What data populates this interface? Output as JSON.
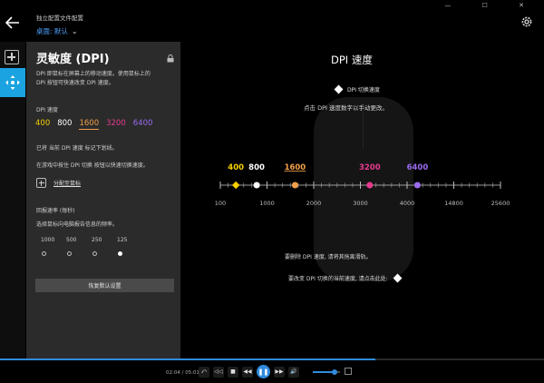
{
  "window": {
    "profile_title": "独立配置文件配置",
    "profile_sub": "桌面: 默认",
    "controls": "— ☐ ✕"
  },
  "panel": {
    "title": "灵敏度 (DPI)",
    "desc_line1": "DPI 即鼠标在屏幕上的移动速度。使用鼠标上的",
    "desc_line2": "DPI 按钮可快速改变 DPI 速度。",
    "dpi_label": "DPI 速度",
    "dpi_values": [
      {
        "label": "400",
        "color": "#f5d000"
      },
      {
        "label": "800",
        "color": "#ffffff"
      },
      {
        "label": "1600",
        "color": "#f2a04a"
      },
      {
        "label": "3200",
        "color": "#e83a8f"
      },
      {
        "label": "6400",
        "color": "#9a6bf0"
      }
    ],
    "note1": "已将 当前 DPI 速度 标记下划线。",
    "note2": "在游戏中按住 DPI 切换 按钮以快速切换速度。",
    "assign_label": "分配至鼠标",
    "report_label": "回报速率 (毎秒)",
    "report_desc": "选择鼠标向电脑报告信息的频率。",
    "report_rates": [
      "1000",
      "500",
      "250",
      "125"
    ],
    "report_selected_index": 3,
    "reset_label": "恢复默认设置"
  },
  "main": {
    "title": "DPI 速度",
    "legend": "DPI 切换速度",
    "hint_edit": "点击 DPI 速度数字以手动更改。",
    "hint_delete": "要删除 DPI 速度, 请将其拖离滑轨。",
    "hint_shift": "要改变 DPI 切换的当前速度, 请点击此处:"
  },
  "chart_data": {
    "type": "scatter",
    "scale_ticks": [
      "100",
      "1000",
      "2000",
      "3000",
      "4000",
      "14800",
      "25600"
    ],
    "points": [
      {
        "value": 400,
        "label": "400",
        "color": "#f5d000",
        "marker": "diamond"
      },
      {
        "value": 800,
        "label": "800",
        "color": "#ffffff",
        "marker": "circle"
      },
      {
        "value": 1600,
        "label": "1600",
        "color": "#f2a04a",
        "marker": "circle",
        "selected": true
      },
      {
        "value": 3200,
        "label": "3200",
        "color": "#e83a8f",
        "marker": "circle"
      },
      {
        "value": 6400,
        "label": "6400",
        "color": "#9a6bf0",
        "marker": "circle"
      }
    ]
  },
  "media": {
    "time": "02:04 / 05:01",
    "progress": 0.69,
    "volume": 0.8,
    "buttons": [
      "⤺",
      "◁◁",
      "■",
      "◀◀",
      "❚❚",
      "▶▶",
      "🔊"
    ]
  }
}
